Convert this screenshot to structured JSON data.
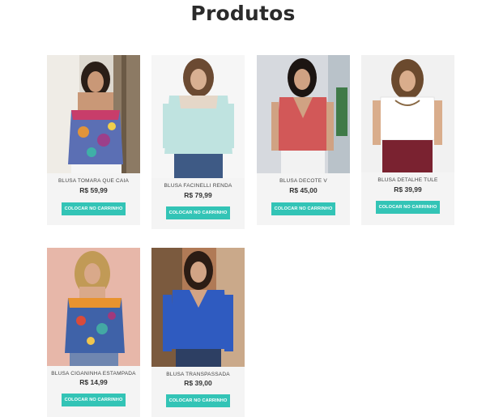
{
  "page": {
    "title": "Produtos"
  },
  "products": [
    {
      "name": "BLUSA TOMARA QUE CAIA",
      "price": "R$ 59,99",
      "button": "COLOCAR NO CARRINHO"
    },
    {
      "name": "BLUSA FACINELLI RENDA",
      "price": "R$ 79,99",
      "button": "COLOCAR NO CARRINHO"
    },
    {
      "name": "BLUSA DECOTE V",
      "price": "R$ 45,00",
      "button": "COLOCAR NO CARRINHO"
    },
    {
      "name": "BLUSA DETALHE TULE",
      "price": "R$ 39,99",
      "button": "COLOCAR NO CARRINHO"
    },
    {
      "name": "BLUSA CIGANINHA ESTAMPADA",
      "price": "R$ 14,99",
      "button": "COLOCAR NO CARRINHO"
    },
    {
      "name": "BLUSA TRANSPASSADA",
      "price": "R$ 39,00",
      "button": "COLOCAR NO CARRINHO"
    }
  ],
  "colors": {
    "button": "#33c4b6",
    "card": "#f4f4f4",
    "title": "#2b2b2b"
  }
}
